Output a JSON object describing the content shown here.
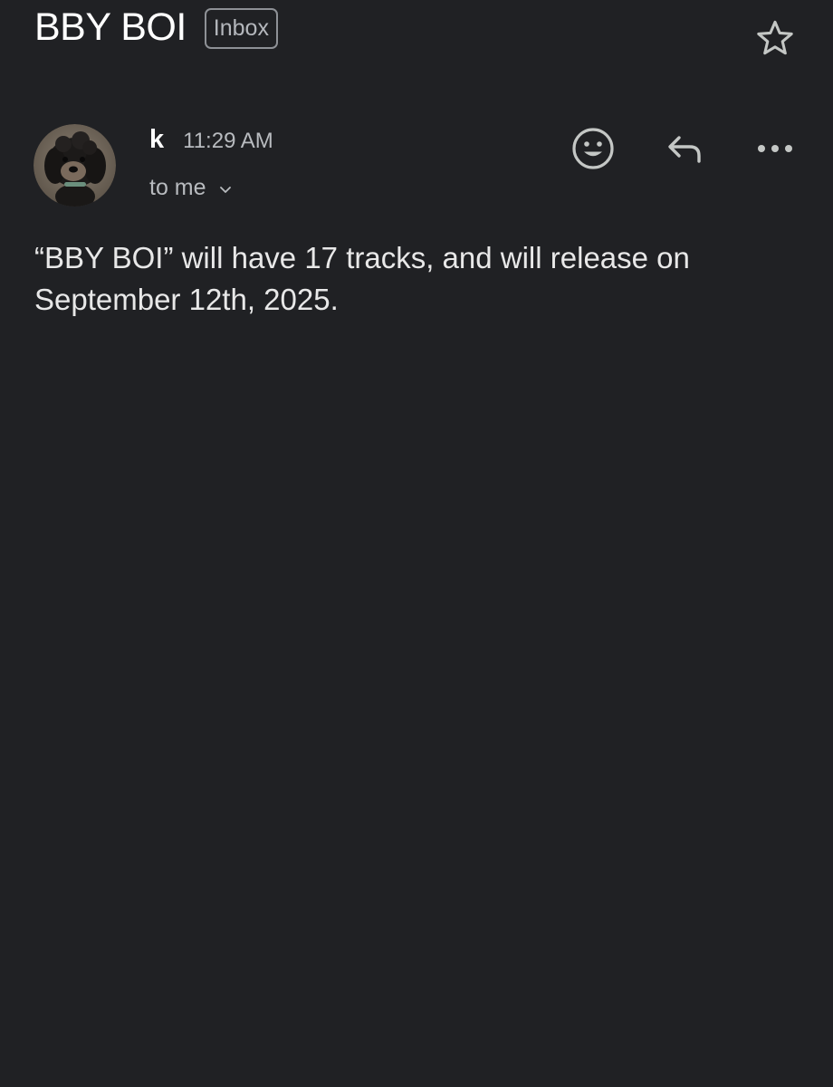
{
  "email": {
    "subject": "BBY BOI",
    "label": "Inbox",
    "sender": {
      "name": "k",
      "time": "11:29 AM",
      "recipient_text": "to me"
    },
    "body": "“BBY BOI” will have 17 tracks, and will release on September 12th, 2025."
  },
  "icons": {
    "star": "star-outline-icon",
    "emoji": "add-reaction-icon",
    "reply": "reply-icon",
    "more": "more-horizontal-icon",
    "chevron": "chevron-down-icon"
  },
  "colors": {
    "background": "#202124",
    "text_primary": "#ffffff",
    "text_secondary": "#b8bbbf",
    "icon": "#c4c7c5"
  }
}
